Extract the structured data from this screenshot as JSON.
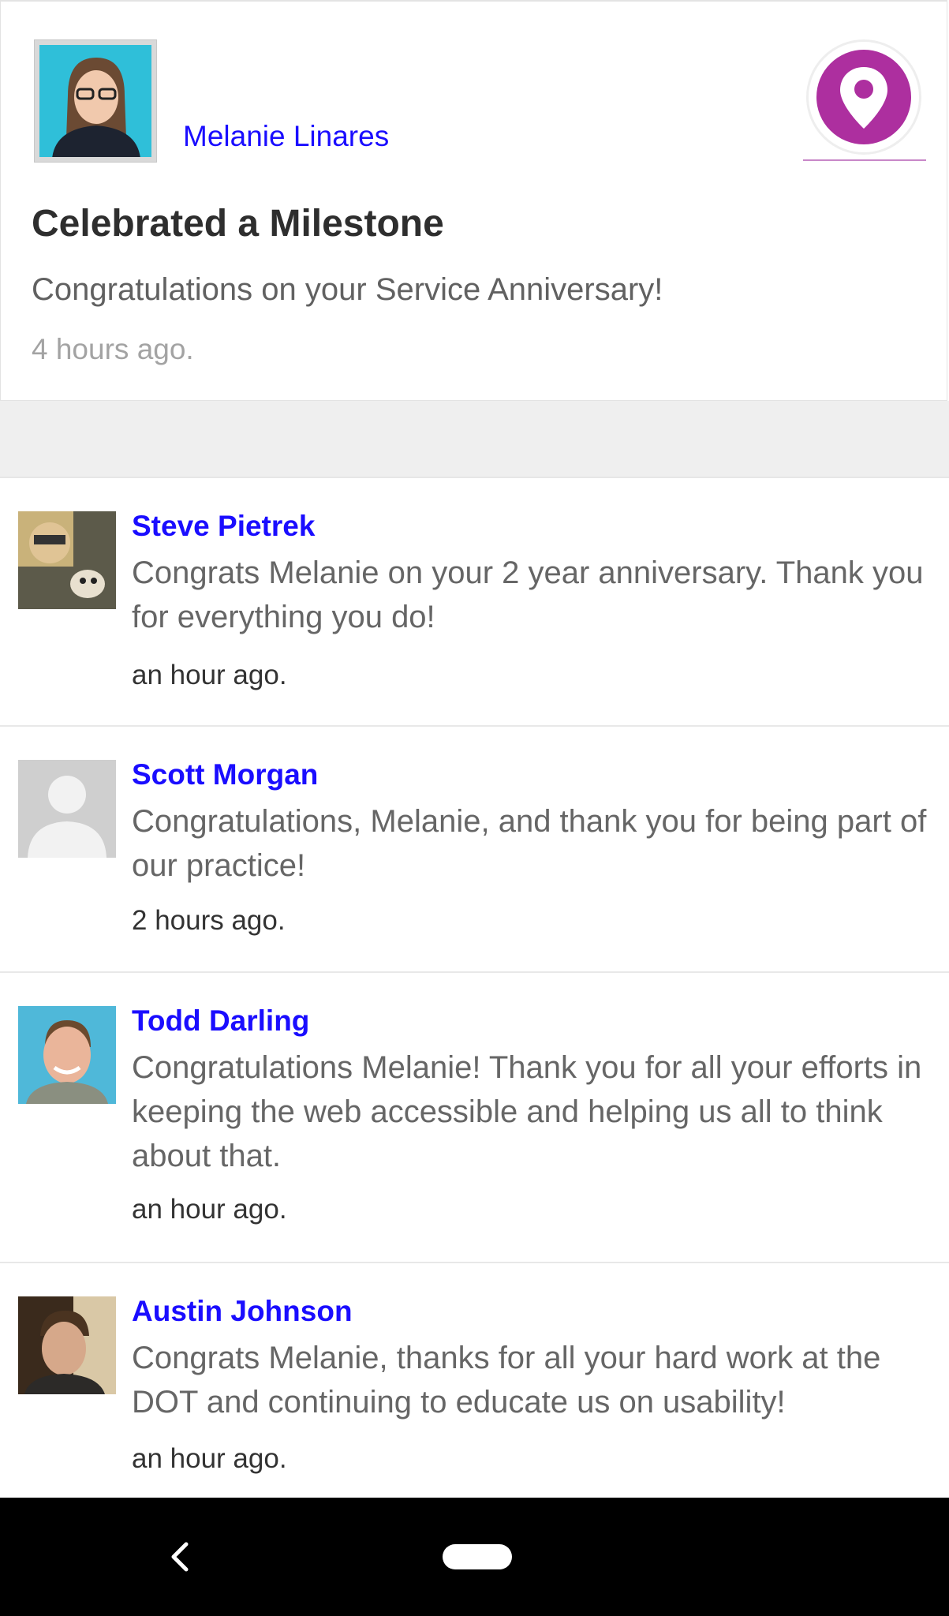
{
  "post": {
    "author_name": "Melanie Linares",
    "title": "Celebrated a Milestone",
    "message": "Congratulations on your Service Anniversary!",
    "time": "4 hours ago.",
    "badge_icon": "location-pin-icon",
    "badge_color": "#ad2f9f"
  },
  "comments": [
    {
      "name": "Steve Pietrek",
      "text": "Congrats Melanie on your 2 year anniversary. Thank you for everything you do!",
      "time": "an hour ago."
    },
    {
      "name": "Scott Morgan",
      "text": "Congratulations, Melanie, and thank you for being part of our practice!",
      "time": "2 hours ago."
    },
    {
      "name": "Todd Darling",
      "text": "Congratulations Melanie! Thank you for all your efforts in keeping the web accessible and helping us all to think about that.",
      "time": "an hour ago."
    },
    {
      "name": "Austin Johnson",
      "text": "Congrats Melanie, thanks for all your hard work at the DOT and continuing to educate us on usability!",
      "time": "an hour ago."
    }
  ],
  "navbar": {
    "back_icon": "chevron-left-icon",
    "home_icon": "home-pill-icon"
  }
}
